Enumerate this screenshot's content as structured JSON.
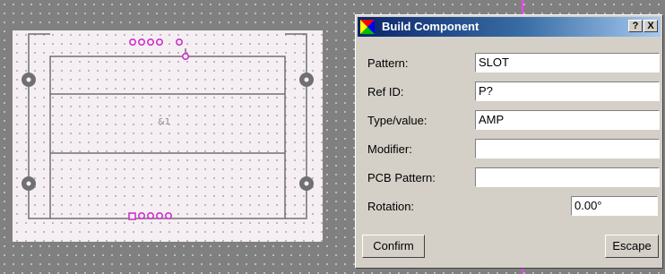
{
  "dialog": {
    "title": "Build Component",
    "help_button": "?",
    "close_button": "X",
    "fields": {
      "pattern": {
        "label": "Pattern:",
        "value": "SLOT"
      },
      "ref_id": {
        "label": "Ref ID:",
        "value": "P?"
      },
      "type_value": {
        "label": "Type/value:",
        "value": "AMP"
      },
      "modifier": {
        "label": "Modifier:",
        "value": ""
      },
      "pcb_pattern": {
        "label": "PCB Pattern:",
        "value": ""
      },
      "rotation": {
        "label": "Rotation:",
        "value": "0.00°"
      }
    },
    "confirm_label": "Confirm",
    "escape_label": "Escape"
  },
  "canvas": {
    "ref_label": "&1",
    "background_color": "#808080",
    "board_color": "#f5eff3",
    "pin_color": "#cc33cc",
    "outline_color": "#707070"
  }
}
